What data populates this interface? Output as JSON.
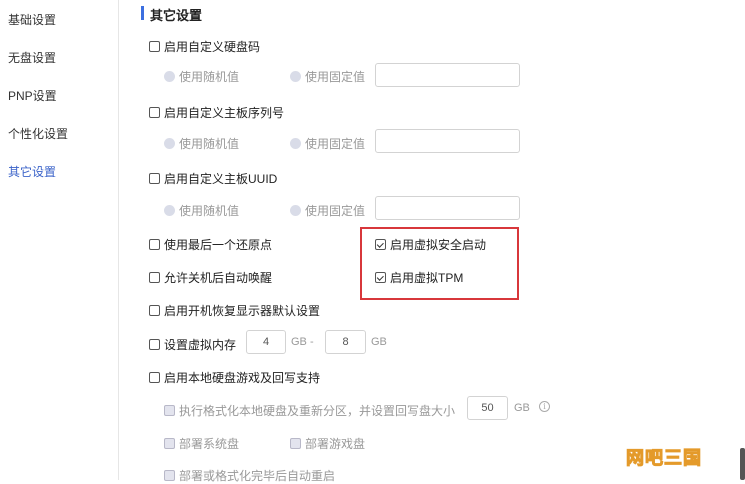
{
  "sidebar": {
    "items": [
      {
        "label": "基础设置"
      },
      {
        "label": "无盘设置"
      },
      {
        "label": "PNP设置"
      },
      {
        "label": "个性化设置"
      },
      {
        "label": "其它设置"
      }
    ],
    "active_index": 4
  },
  "section": {
    "title": "其它设置"
  },
  "disk_code": {
    "label": "启用自定义硬盘码",
    "checked": false,
    "radio_random": "使用随机值",
    "radio_fixed": "使用固定值",
    "value": ""
  },
  "board_serial": {
    "label": "启用自定义主板序列号",
    "checked": false,
    "radio_random": "使用随机值",
    "radio_fixed": "使用固定值",
    "value": ""
  },
  "board_uuid": {
    "label": "启用自定义主板UUID",
    "checked": false,
    "radio_random": "使用随机值",
    "radio_fixed": "使用固定值",
    "value": ""
  },
  "options": {
    "last_restore_point": {
      "label": "使用最后一个还原点",
      "checked": false
    },
    "wake_after_shutdown": {
      "label": "允许关机后自动唤醒",
      "checked": false
    },
    "virtual_secure_boot": {
      "label": "启用虚拟安全启动",
      "checked": true
    },
    "virtual_tpm": {
      "label": "启用虚拟TPM",
      "checked": true
    },
    "restore_display": {
      "label": "启用开机恢复显示器默认设置",
      "checked": false
    },
    "virtual_memory": {
      "label": "设置虚拟内存",
      "checked": false,
      "min": "4",
      "min_unit": "GB -",
      "max": "8",
      "max_unit": "GB"
    },
    "local_disk": {
      "label": "启用本地硬盘游戏及回写支持",
      "checked": false
    }
  },
  "local_disk_sub": {
    "format_label": "执行格式化本地硬盘及重新分区，并设置回写盘大小",
    "format_size": "50",
    "format_unit": "GB",
    "deploy_system": "部署系统盘",
    "deploy_game": "部署游戏盘",
    "auto_restart": "部署或格式化完毕后自动重启"
  },
  "watermark": "网吧三国",
  "colors": {
    "accent": "#3c6fe0",
    "highlight": "#d8373b",
    "watermark": "#f5c75a"
  }
}
